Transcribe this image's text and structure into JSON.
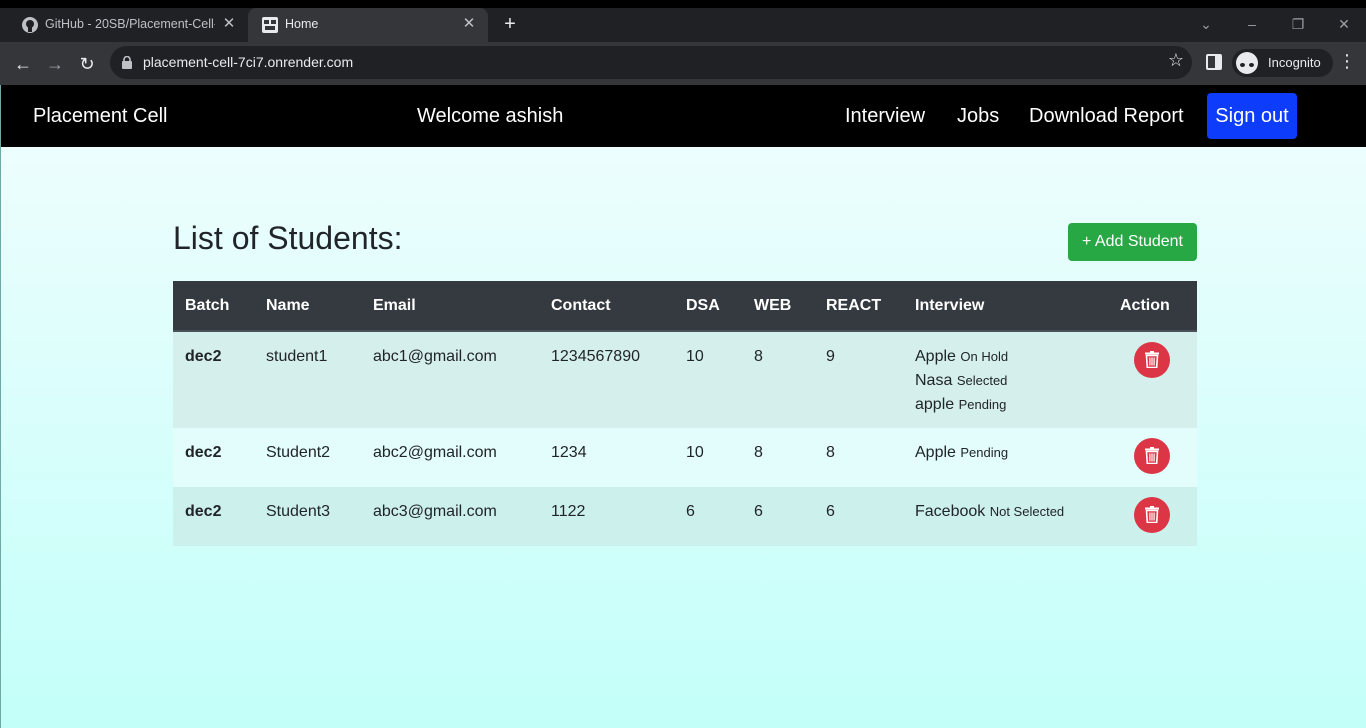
{
  "browser": {
    "tabs": [
      {
        "title": "GitHub - 20SB/Placement-Cell-Backend",
        "active": false
      },
      {
        "title": "Home",
        "active": true
      }
    ],
    "url": "placement-cell-7ci7.onrender.com",
    "profile_label": "Incognito"
  },
  "navbar": {
    "brand": "Placement Cell",
    "welcome": "Welcome ashish",
    "links": [
      "Interview",
      "Jobs",
      "Download Report"
    ],
    "signout": "Sign out"
  },
  "main": {
    "heading": "List of Students:",
    "add_button": "+ Add Student",
    "columns": [
      "Batch",
      "Name",
      "Email",
      "Contact",
      "DSA",
      "WEB",
      "REACT",
      "Interview",
      "Action"
    ],
    "rows": [
      {
        "batch": "dec2",
        "name": "student1",
        "email": "abc1@gmail.com",
        "contact": "1234567890",
        "dsa": "10",
        "web": "8",
        "react": "9",
        "interviews": [
          {
            "company": "Apple",
            "status": "On Hold"
          },
          {
            "company": "Nasa",
            "status": "Selected"
          },
          {
            "company": "apple",
            "status": "Pending"
          }
        ]
      },
      {
        "batch": "dec2",
        "name": "Student2",
        "email": "abc2@gmail.com",
        "contact": "1234",
        "dsa": "10",
        "web": "8",
        "react": "8",
        "interviews": [
          {
            "company": "Apple",
            "status": "Pending"
          }
        ]
      },
      {
        "batch": "dec2",
        "name": "Student3",
        "email": "abc3@gmail.com",
        "contact": "1122",
        "dsa": "6",
        "web": "6",
        "react": "6",
        "interviews": [
          {
            "company": "Facebook",
            "status": "Not Selected"
          }
        ]
      }
    ]
  },
  "colors": {
    "navbar_bg": "#000000",
    "signout_bg": "#0d3dfb",
    "add_button_bg": "#28a745",
    "delete_button_bg": "#dc3545",
    "table_header_bg": "#343a40"
  }
}
